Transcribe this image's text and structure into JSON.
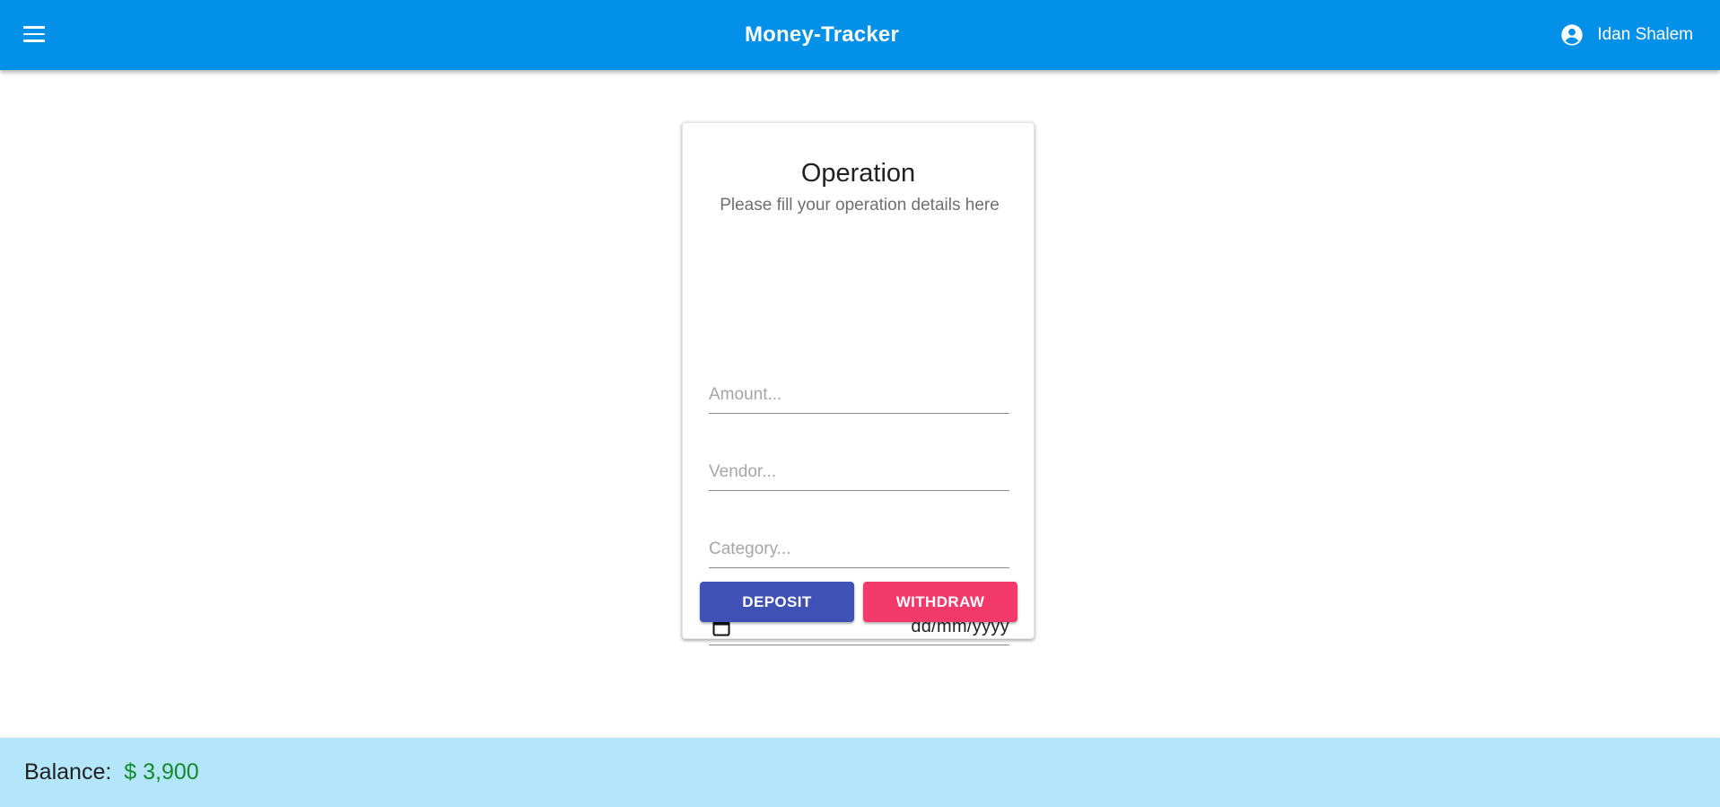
{
  "header": {
    "menu_icon": "menu-icon",
    "title": "Money-Tracker",
    "user_icon": "account-circle-icon",
    "user_name": "Idan Shalem"
  },
  "operation_form": {
    "title": "Operation",
    "subtitle": "Please fill your operation details here",
    "amount_placeholder": "Amount...",
    "vendor_placeholder": "Vendor...",
    "category_placeholder": "Category...",
    "date_placeholder": "dd/mm/yyyy",
    "date_icon": "calendar-icon",
    "deposit_label": "DEPOSIT",
    "withdraw_label": "WITHDRAW"
  },
  "footer": {
    "balance_label": "Balance:",
    "balance_value": "$ 3,900"
  },
  "colors": {
    "appbar": "#0290e8",
    "deposit": "#3f51b5",
    "withdraw": "#f3386a",
    "footer": "#b3e5fb",
    "balance_value": "#138a2e"
  }
}
